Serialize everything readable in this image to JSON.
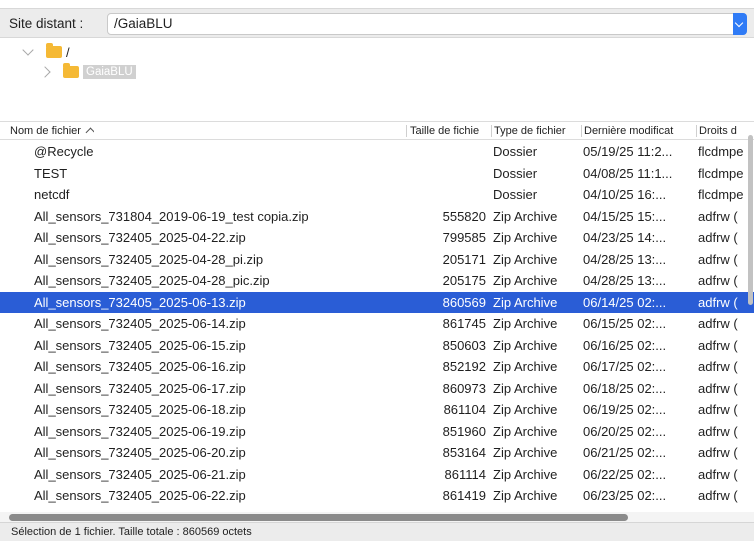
{
  "site": {
    "label": "Site distant :",
    "path": "/GaiaBLU"
  },
  "tree": {
    "root": "/",
    "child": "GaiaBLU"
  },
  "columns": {
    "name": "Nom de fichier",
    "size": "Taille de fichie",
    "type": "Type de fichier",
    "date": "Dernière modificat",
    "perms": "Droits d"
  },
  "rows": [
    {
      "icon": "folder",
      "name": "@Recycle",
      "size": "",
      "type": "Dossier",
      "date": "05/19/25 11:2...",
      "perms": "flcdmpe"
    },
    {
      "icon": "folder",
      "name": "TEST",
      "size": "",
      "type": "Dossier",
      "date": "04/08/25 11:1...",
      "perms": "flcdmpe"
    },
    {
      "icon": "folder",
      "name": "netcdf",
      "size": "",
      "type": "Dossier",
      "date": "04/10/25 16:...",
      "perms": "flcdmpe"
    },
    {
      "icon": "zip",
      "name": "All_sensors_731804_2019-06-19_test copia.zip",
      "size": "555820",
      "type": "Zip Archive",
      "date": "04/15/25 15:...",
      "perms": "adfrw ("
    },
    {
      "icon": "zip",
      "name": "All_sensors_732405_2025-04-22.zip",
      "size": "799585",
      "type": "Zip Archive",
      "date": "04/23/25 14:...",
      "perms": "adfrw ("
    },
    {
      "icon": "zip",
      "name": "All_sensors_732405_2025-04-28_pi.zip",
      "size": "205171",
      "type": "Zip Archive",
      "date": "04/28/25 13:...",
      "perms": "adfrw ("
    },
    {
      "icon": "zip",
      "name": "All_sensors_732405_2025-04-28_pic.zip",
      "size": "205175",
      "type": "Zip Archive",
      "date": "04/28/25 13:...",
      "perms": "adfrw ("
    },
    {
      "icon": "zip",
      "name": "All_sensors_732405_2025-06-13.zip",
      "size": "860569",
      "type": "Zip Archive",
      "date": "06/14/25 02:...",
      "perms": "adfrw (",
      "selected": true
    },
    {
      "icon": "zip",
      "name": "All_sensors_732405_2025-06-14.zip",
      "size": "861745",
      "type": "Zip Archive",
      "date": "06/15/25 02:...",
      "perms": "adfrw ("
    },
    {
      "icon": "zip",
      "name": "All_sensors_732405_2025-06-15.zip",
      "size": "850603",
      "type": "Zip Archive",
      "date": "06/16/25 02:...",
      "perms": "adfrw ("
    },
    {
      "icon": "zip",
      "name": "All_sensors_732405_2025-06-16.zip",
      "size": "852192",
      "type": "Zip Archive",
      "date": "06/17/25 02:...",
      "perms": "adfrw ("
    },
    {
      "icon": "zip",
      "name": "All_sensors_732405_2025-06-17.zip",
      "size": "860973",
      "type": "Zip Archive",
      "date": "06/18/25 02:...",
      "perms": "adfrw ("
    },
    {
      "icon": "zip",
      "name": "All_sensors_732405_2025-06-18.zip",
      "size": "861104",
      "type": "Zip Archive",
      "date": "06/19/25 02:...",
      "perms": "adfrw ("
    },
    {
      "icon": "zip",
      "name": "All_sensors_732405_2025-06-19.zip",
      "size": "851960",
      "type": "Zip Archive",
      "date": "06/20/25 02:...",
      "perms": "adfrw ("
    },
    {
      "icon": "zip",
      "name": "All_sensors_732405_2025-06-20.zip",
      "size": "853164",
      "type": "Zip Archive",
      "date": "06/21/25 02:...",
      "perms": "adfrw ("
    },
    {
      "icon": "zip",
      "name": "All_sensors_732405_2025-06-21.zip",
      "size": "861114",
      "type": "Zip Archive",
      "date": "06/22/25 02:...",
      "perms": "adfrw ("
    },
    {
      "icon": "zip",
      "name": "All_sensors_732405_2025-06-22.zip",
      "size": "861419",
      "type": "Zip Archive",
      "date": "06/23/25 02:...",
      "perms": "adfrw ("
    }
  ],
  "status": "Sélection de 1 fichier. Taille totale : 860569 octets",
  "colors": {
    "selection": "#2a5dd6",
    "folder": "#f5b935",
    "accent": "#2f7bf6"
  }
}
